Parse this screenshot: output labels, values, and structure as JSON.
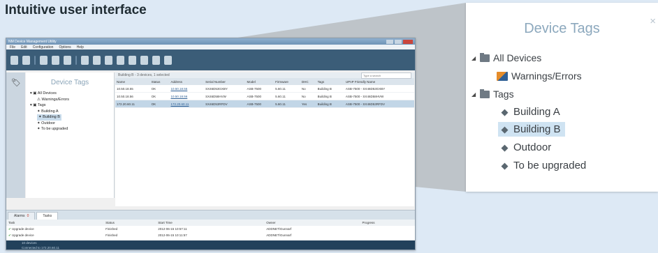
{
  "headline": "Intuitive user interface",
  "app": {
    "title": "NM Device Management Utility",
    "menu": [
      "File",
      "Edit",
      "Configuration",
      "Options",
      "Help"
    ],
    "left_panel": {
      "title": "Device Tags",
      "tree": [
        "All Devices",
        "Warnings/Errors",
        "Tags",
        "Building A",
        "Building B",
        "Outdoor",
        "To be upgraded"
      ]
    },
    "grid": {
      "filter_label": "Building B - 3 devices, 1 selected",
      "search_placeholder": "Type a search",
      "columns": [
        "Name",
        "Status",
        "Address",
        "Serial Number",
        "Model",
        "Firmware",
        "DHC",
        "Tags",
        "UPnP Friendly Name"
      ],
      "rows": [
        [
          "10.50.18.55",
          "OK",
          "10.50.18.55",
          "SX46D53GXBY",
          "ASB-7500",
          "5.60.11",
          "No",
          "Building B",
          "ASB-7500 - SX46D53GXBY"
        ],
        [
          "10.50.18.56",
          "OK",
          "10.50.18.56",
          "SX46D58HVW",
          "ASB-7500",
          "5.60.11",
          "No",
          "Building B",
          "ASB-7500 - SX46D58HVW"
        ],
        [
          "172.20.60.11",
          "OK",
          "172.20.60.11",
          "SX46D53RFDV",
          "ASB-7500",
          "5.60.11",
          "Yes",
          "Building B",
          "ASB-7500 - SX46D53RFDV"
        ]
      ]
    },
    "bottom": {
      "tabs": [
        "Alarms",
        "Tasks"
      ],
      "alarm_count": "0",
      "columns": [
        "Task",
        "Status",
        "Start Time",
        "Owner",
        "Progress"
      ],
      "rows": [
        [
          "Upgrade device",
          "Finished",
          "2012-06-15 10:57:11",
          "ADDNET\\Gunnarf",
          ""
        ],
        [
          "Upgrade device",
          "Finished",
          "2012-06-15 10:11:57",
          "ADDNET\\Gunnarf",
          ""
        ]
      ]
    },
    "status": [
      "10 devices",
      "Connected to 172.20.60.11"
    ]
  },
  "zoom": {
    "title": "Device Tags",
    "close": "×",
    "items": {
      "all_devices": "All Devices",
      "warnings": "Warnings/Errors",
      "tags": "Tags",
      "building_a": "Building A",
      "building_b": "Building B",
      "outdoor": "Outdoor",
      "to_be_upgraded": "To be upgraded"
    }
  },
  "colors": {
    "accent": "#3b5d78",
    "selection": "#cfe3f2",
    "title_blue": "#8ca8bd"
  }
}
